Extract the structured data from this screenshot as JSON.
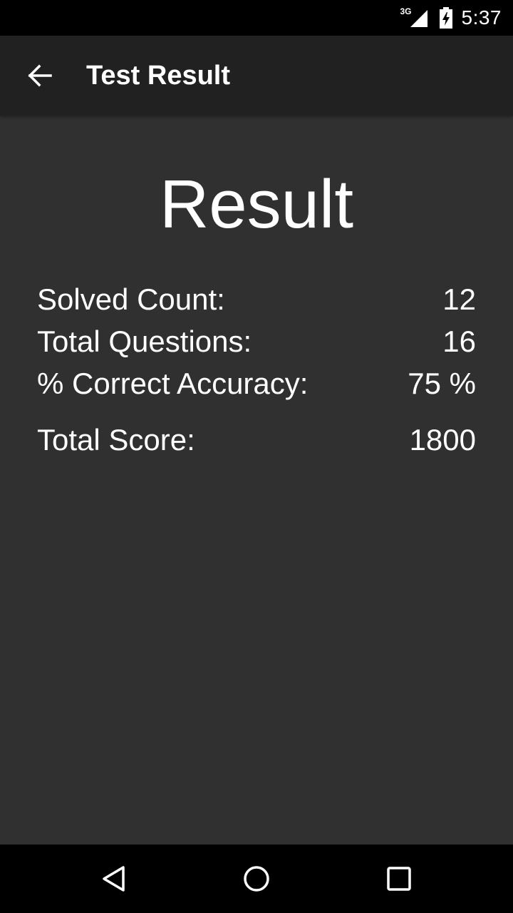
{
  "status_bar": {
    "network_type": "3G",
    "time": "5:37",
    "signal_icon": "cell-signal-icon",
    "battery_icon": "battery-charging-icon"
  },
  "app_bar": {
    "back_icon": "arrow-back-icon",
    "title": "Test Result"
  },
  "result": {
    "heading": "Result",
    "rows": [
      {
        "label": "Solved Count:",
        "value": "12"
      },
      {
        "label": "Total Questions:",
        "value": "16"
      },
      {
        "label": "% Correct Accuracy:",
        "value": "75 %"
      },
      {
        "label": "Total Score:",
        "value": "1800"
      }
    ]
  },
  "nav_bar": {
    "back_icon": "nav-back-icon",
    "home_icon": "nav-home-icon",
    "recents_icon": "nav-recents-icon"
  }
}
